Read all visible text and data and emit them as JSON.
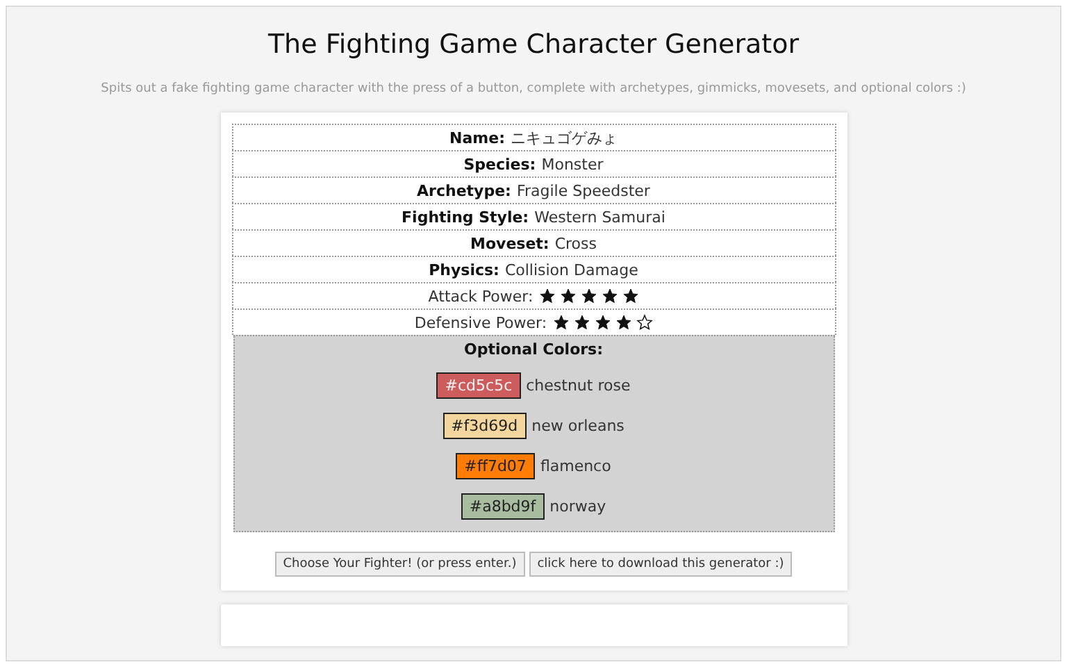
{
  "title": "The Fighting Game Character Generator",
  "subtitle": "Spits out a fake fighting game character with the press of a button, complete with archetypes, gimmicks, movesets, and optional colors :)",
  "fields": [
    {
      "label": "Name:",
      "value": "ニキュゴゲみょ"
    },
    {
      "label": "Species:",
      "value": "Monster"
    },
    {
      "label": "Archetype:",
      "value": "Fragile Speedster"
    },
    {
      "label": "Fighting Style:",
      "value": "Western Samurai"
    },
    {
      "label": "Moveset:",
      "value": "Cross"
    },
    {
      "label": "Physics:",
      "value": "Collision Damage"
    }
  ],
  "ratings": [
    {
      "label": "Attack Power:",
      "stars": 5
    },
    {
      "label": "Defensive Power:",
      "stars": 4
    }
  ],
  "colors_heading": "Optional Colors:",
  "colors": [
    {
      "hex": "#cd5c5c",
      "name": "chestnut rose",
      "color": "#cd5c5c"
    },
    {
      "hex": "#f3d69d",
      "name": "new orleans",
      "color": "#f3d69d"
    },
    {
      "hex": "#ff7d07",
      "name": "flamenco",
      "color": "#ff7d07"
    },
    {
      "hex": "#a8bd9f",
      "name": "norway",
      "color": "#a8bd9f"
    }
  ],
  "buttons": [
    "Choose Your Fighter! (or press enter.)",
    "click here to download this generator :)"
  ]
}
